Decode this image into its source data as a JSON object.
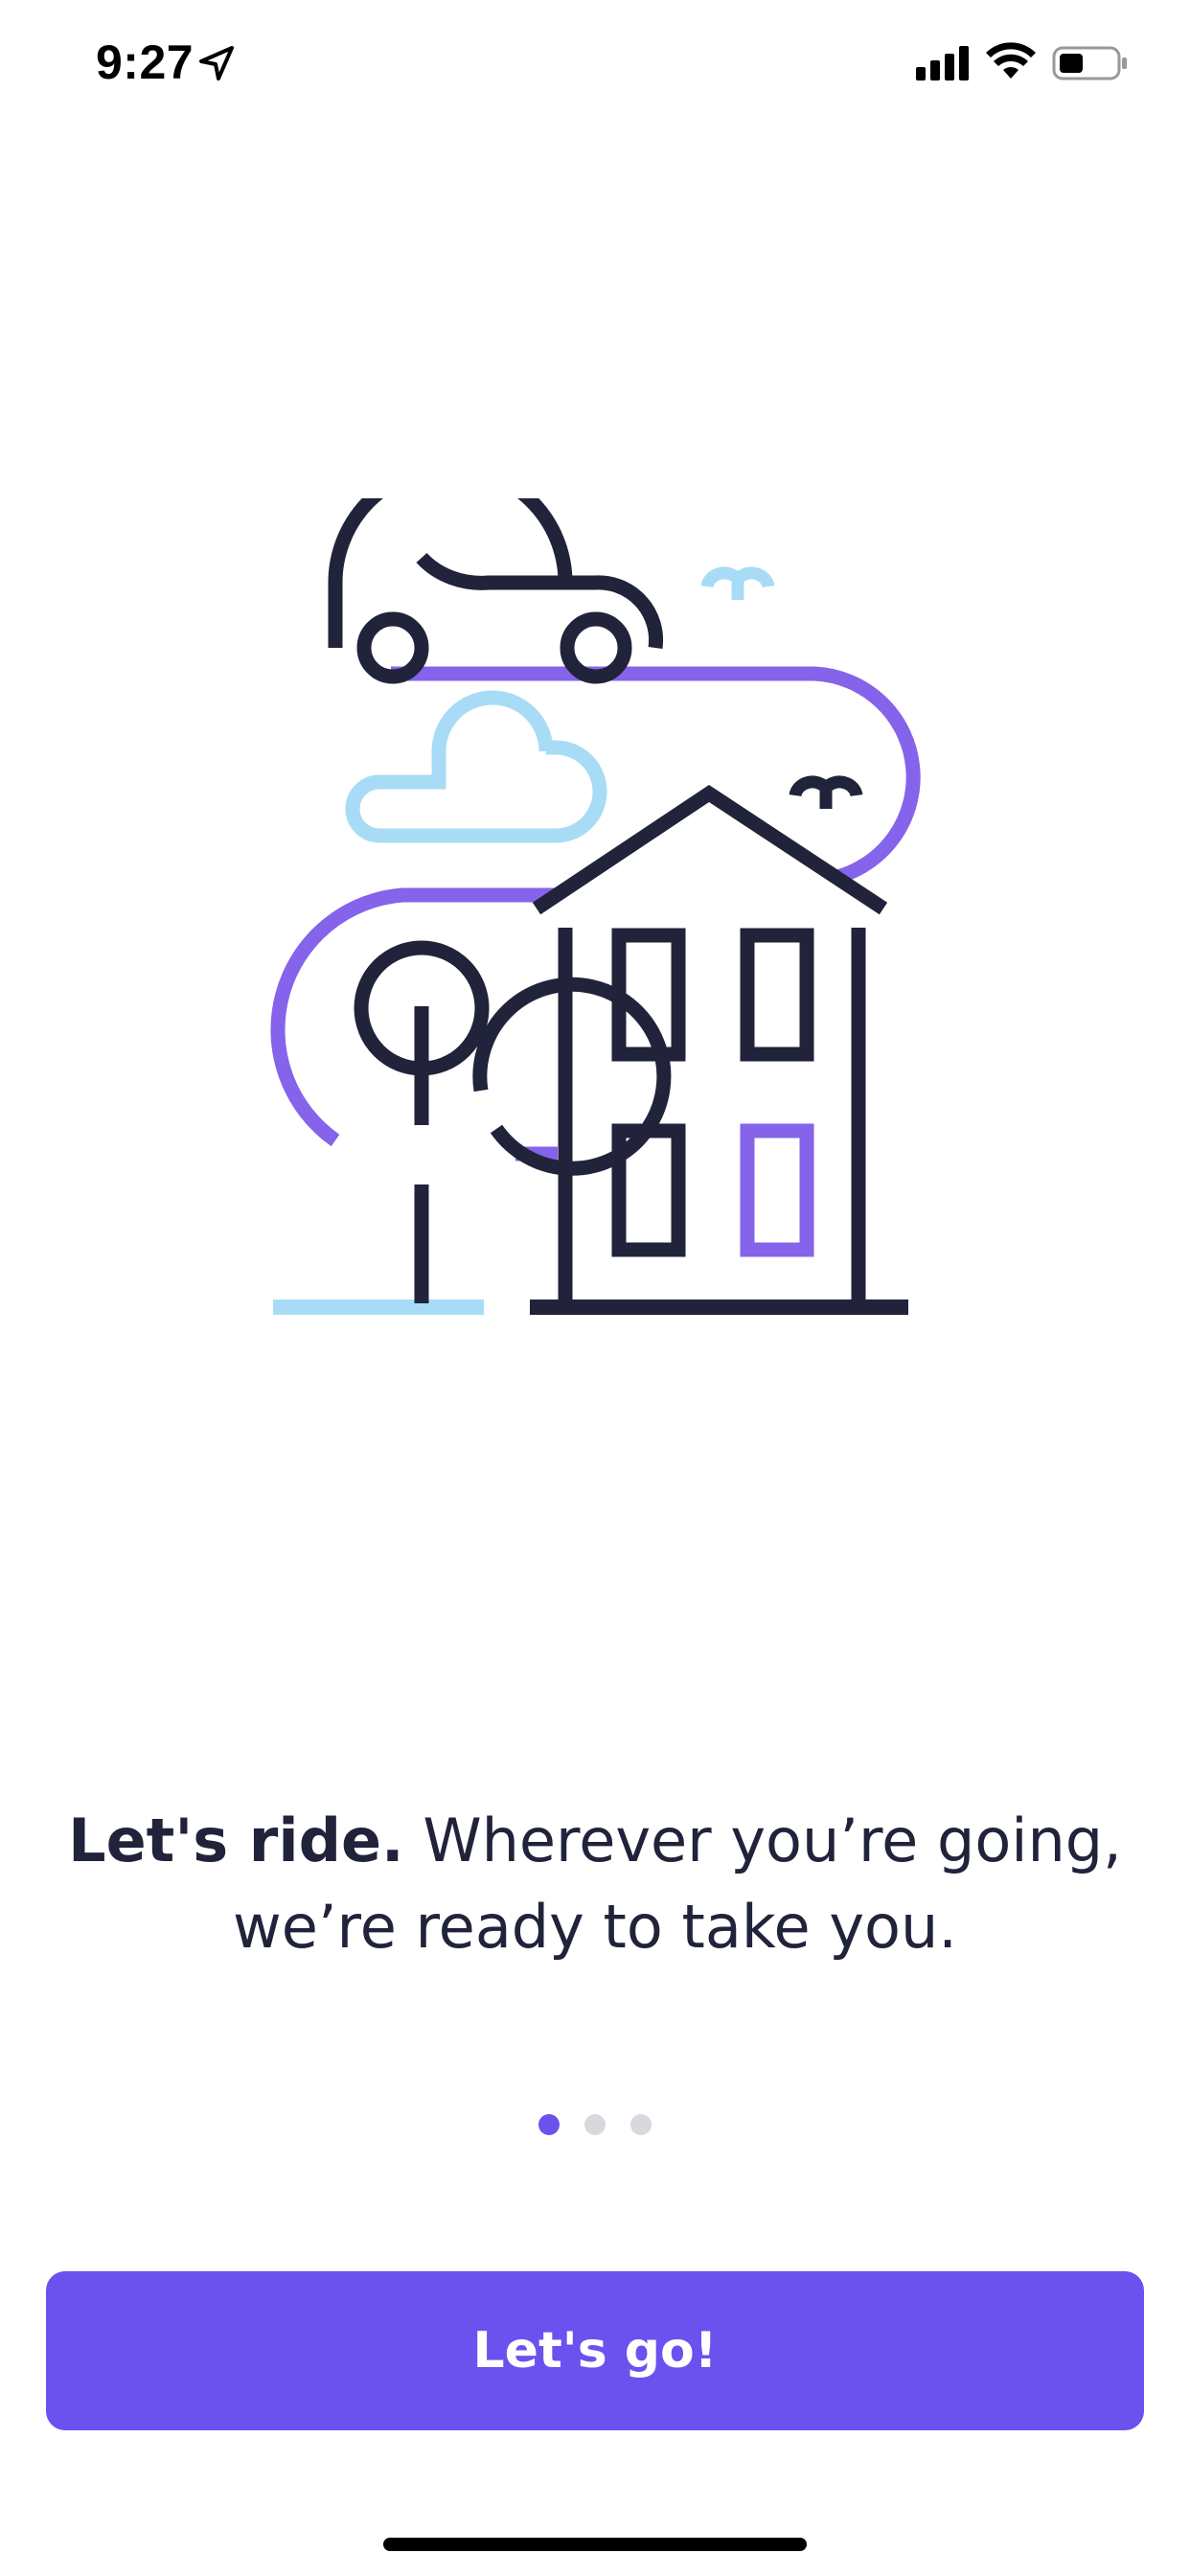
{
  "status_bar": {
    "time": "9:27",
    "icons": [
      "location-arrow-icon",
      "cellular-signal-icon",
      "wifi-icon",
      "battery-icon"
    ]
  },
  "illustration": {
    "subject": "car-house-tree-cloud-illustration",
    "colors": {
      "navy": "#20233a",
      "purple": "#8563ea",
      "light_blue": "#a8dcf6"
    }
  },
  "onboarding": {
    "headline_bold": "Let's ride.",
    "headline_rest": " Wherever you’re going, we’re ready to take you.",
    "page_count": 3,
    "active_page": 1
  },
  "cta": {
    "label": "Let's go!"
  },
  "colors": {
    "accent": "#6b52ef",
    "text": "#20233a",
    "dot_inactive": "#d8d8de"
  }
}
